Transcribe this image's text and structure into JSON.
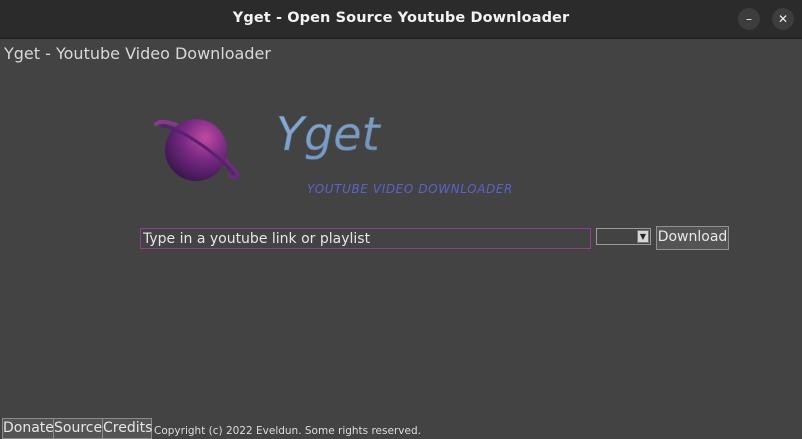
{
  "window": {
    "title": "Yget - Open Source Youtube Downloader",
    "minimize_glyph": "–",
    "close_glyph": "✕"
  },
  "app": {
    "heading": "Yget - Youtube Video Downloader"
  },
  "logo": {
    "wordmark": "Yget",
    "tagline": "YOUTUBE VIDEO DOWNLOADER",
    "planet_icon": "planet-icon"
  },
  "form": {
    "url_placeholder": "Type in a youtube link or playlist",
    "url_value": "",
    "format_selected": "",
    "download_label": "Download"
  },
  "footer": {
    "donate_label": "Donate",
    "source_label": "Source",
    "credits_label": "Credits",
    "copyright": "Copyright (c) 2022 Eveldun. Some rights reserved."
  },
  "colors": {
    "background": "#434343",
    "titlebar": "#2b2b2b",
    "input_border": "#8d3f8d",
    "tagline": "#5a63c9"
  }
}
